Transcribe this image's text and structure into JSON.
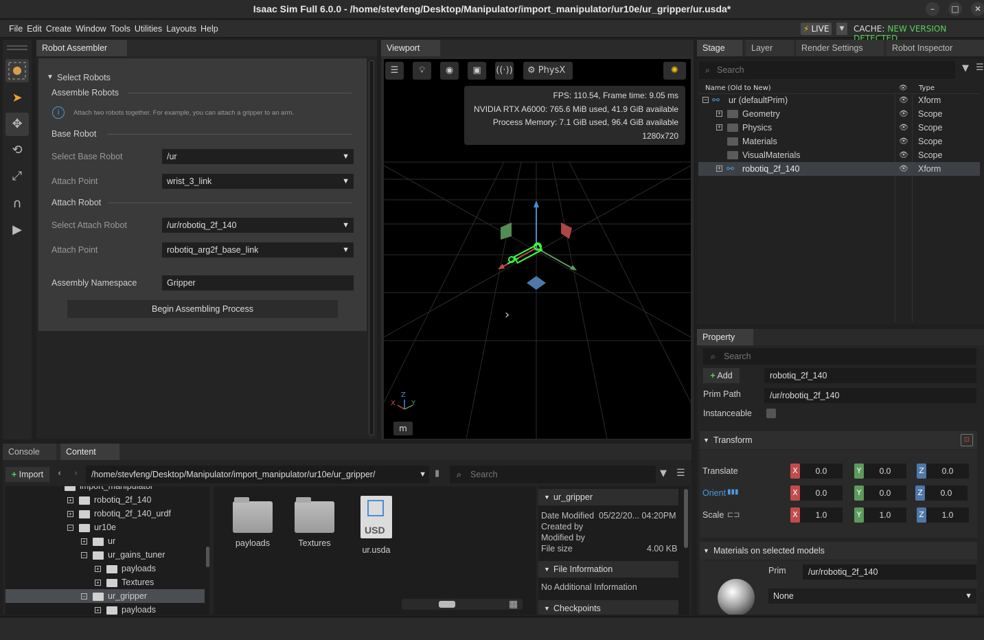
{
  "window": {
    "title": "Isaac Sim Full 6.0.0 - /home/stevfeng/Desktop/Manipulator/import_manipulator/ur10e/ur_gripper/ur.usda*"
  },
  "menu": [
    "File",
    "Edit",
    "Create",
    "Window",
    "Tools",
    "Utilities",
    "Layouts",
    "Help"
  ],
  "live": {
    "label": "LIVE",
    "cache_label": "CACHE:",
    "cache_status": "NEW VERSION DETECTED",
    "cache_color": "#5ad15a"
  },
  "robot_assembler": {
    "tab": "Robot Assembler",
    "section": "Select Robots",
    "assemble_header": "Assemble Robots",
    "info": "Attach two robots together. For example, you can attach a gripper to an arm.",
    "base_header": "Base Robot",
    "select_base_label": "Select Base Robot",
    "select_base_value": "/ur",
    "attach_point_label": "Attach Point",
    "base_attach_value": "wrist_3_link",
    "attach_header": "Attach Robot",
    "select_attach_label": "Select Attach Robot",
    "select_attach_value": "/ur/robotiq_2f_140",
    "attach_point_label2": "Attach Point",
    "attach_point_value": "robotiq_arg2f_base_link",
    "namespace_label": "Assembly Namespace",
    "namespace_value": "Gripper",
    "begin_button": "Begin Assembling Process"
  },
  "viewport": {
    "tab": "Viewport",
    "physx_label": "PhysX",
    "stats": [
      "FPS: 110.54, Frame time: 9.05 ms",
      "NVIDIA RTX A6000: 765.6 MiB used, 41.9 GiB available",
      "Process Memory: 7.1 GiB used, 96.4 GiB available",
      "1280x720"
    ],
    "axes": {
      "x": "X",
      "y": "Y",
      "z": "Z"
    },
    "units": "m"
  },
  "stage": {
    "tabs": [
      "Stage",
      "Layer",
      "Render Settings",
      "Robot Inspector"
    ],
    "search_placeholder": "Search",
    "col_name": "Name (Old to New)",
    "col_type": "Type",
    "rows": [
      {
        "name": "ur (defaultPrim)",
        "type": "Xform"
      },
      {
        "name": "Geometry",
        "type": "Scope"
      },
      {
        "name": "Physics",
        "type": "Scope"
      },
      {
        "name": "Materials",
        "type": "Scope"
      },
      {
        "name": "VisualMaterials",
        "type": "Scope"
      },
      {
        "name": "robotiq_2f_140",
        "type": "Xform"
      }
    ]
  },
  "property": {
    "tab": "Property",
    "search_placeholder": "Search",
    "add_label": "Add",
    "name_value": "robotiq_2f_140",
    "prim_path_label": "Prim Path",
    "prim_path_value": "/ur/robotiq_2f_140",
    "instanceable_label": "Instanceable",
    "transform_header": "Transform",
    "translate_label": "Translate",
    "orient_label": "Orient",
    "scale_label": "Scale",
    "translate": [
      "0.0",
      "0.0",
      "0.0"
    ],
    "orient": [
      "0.0",
      "0.0",
      "0.0"
    ],
    "scale": [
      "1.0",
      "1.0",
      "1.0"
    ],
    "materials_header": "Materials on selected models",
    "prim_label": "Prim",
    "prim_value": "/ur/robotiq_2f_140",
    "material_value": "None"
  },
  "content": {
    "tabs": [
      "Console",
      "Content"
    ],
    "import_label": "Import",
    "path": "/home/stevfeng/Desktop/Manipulator/import_manipulator/ur10e/ur_gripper/",
    "search_placeholder": "Search",
    "tree": [
      {
        "label": "import_manipulator",
        "level": 0
      },
      {
        "label": "robotiq_2f_140",
        "level": 1
      },
      {
        "label": "robotiq_2f_140_urdf",
        "level": 1
      },
      {
        "label": "ur10e",
        "level": 1
      },
      {
        "label": "ur",
        "level": 2
      },
      {
        "label": "ur_gains_tuner",
        "level": 2
      },
      {
        "label": "payloads",
        "level": 3
      },
      {
        "label": "Textures",
        "level": 3
      },
      {
        "label": "ur_gripper",
        "level": 2
      },
      {
        "label": "payloads",
        "level": 3
      }
    ],
    "files": [
      "payloads",
      "Textures",
      "ur.usda"
    ],
    "details": {
      "name": "ur_gripper",
      "date_label": "Date Modified",
      "date_value": "05/22/20... 04:20PM",
      "created_label": "Created by",
      "modified_label": "Modified by",
      "size_label": "File size",
      "size_value": "4.00 KB",
      "file_info_header": "File Information",
      "file_info_text": "No Additional Information",
      "checkpoints_header": "Checkpoints"
    }
  }
}
